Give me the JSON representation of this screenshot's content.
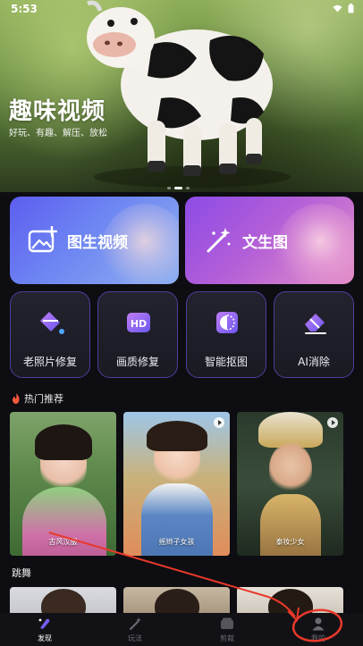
{
  "status": {
    "time": "5:53"
  },
  "banner": {
    "title": "趣味视频",
    "subtitle": "好玩、有趣、解压、放松",
    "page_indicator": {
      "count": 3,
      "active": 1
    }
  },
  "feature_cards": [
    {
      "label": "图生视频",
      "icon": "image-plus-icon"
    },
    {
      "label": "文生图",
      "icon": "magic-wand-icon"
    }
  ],
  "tools": [
    {
      "label": "老照片修复",
      "icon": "paint-bucket-icon"
    },
    {
      "label": "画质修复",
      "icon": "hd-icon"
    },
    {
      "label": "智能抠图",
      "icon": "cutout-icon"
    },
    {
      "label": "AI消除",
      "icon": "eraser-icon"
    }
  ],
  "hot_section": {
    "title": "热门推荐",
    "icon": "flame-icon"
  },
  "hot_videos": [
    {
      "caption": "古风汉服",
      "has_play": false
    },
    {
      "caption": "摇辫子女孩",
      "has_play": true
    },
    {
      "caption": "泰妆少女",
      "has_play": true
    }
  ],
  "dance_section": {
    "title": "跳舞"
  },
  "bottom_nav": [
    {
      "label": "发现",
      "icon": "discover-icon",
      "active": true
    },
    {
      "label": "玩法",
      "icon": "magic-wand-icon",
      "active": false
    },
    {
      "label": "剪裁",
      "icon": "folder-icon",
      "active": false
    },
    {
      "label": "我的",
      "icon": "user-icon",
      "active": false
    }
  ],
  "colors": {
    "background": "#0d0d12",
    "accent_blue": "#5d5ef0",
    "accent_purple": "#8d4be6",
    "annotation_red": "#e8392a"
  }
}
